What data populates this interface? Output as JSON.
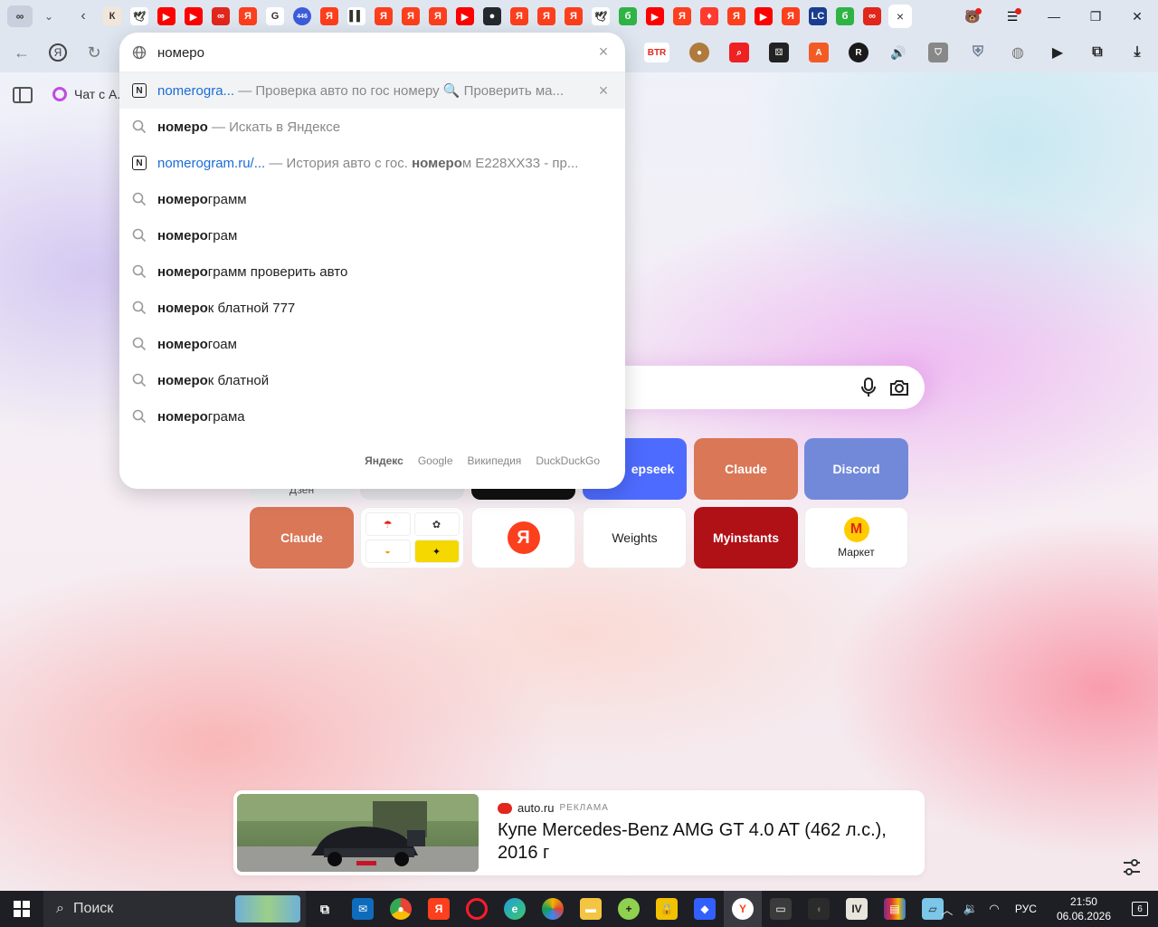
{
  "tabbar": {
    "group_icon": "infinity-icon",
    "tab_count_badge": "446",
    "tabs": [
      {
        "icon": "kitten-icon",
        "color": "#f2e6da",
        "glyph": "К"
      },
      {
        "icon": "bird-icon",
        "color": "#ffffff",
        "glyph": "🕊"
      },
      {
        "icon": "youtube-icon",
        "color": "#ff0000",
        "glyph": "▶"
      },
      {
        "icon": "youtube-icon",
        "color": "#ff0000",
        "glyph": "▶"
      },
      {
        "icon": "autoru-icon",
        "color": "#e1261c",
        "glyph": "∞"
      },
      {
        "icon": "yandex-icon",
        "color": "#fc3f1d",
        "glyph": "Я"
      },
      {
        "icon": "google-icon",
        "color": "#ffffff",
        "glyph": "G"
      },
      {
        "icon": "badge-icon",
        "color": "#3b5bdb",
        "glyph": "446"
      },
      {
        "icon": "yandex-icon",
        "color": "#fc3f1d",
        "glyph": "Я"
      },
      {
        "icon": "audio-icon",
        "color": "#ffffff",
        "glyph": "▌▌"
      },
      {
        "icon": "yandex-icon",
        "color": "#fc3f1d",
        "glyph": "Я"
      },
      {
        "icon": "yandex-icon",
        "color": "#fc3f1d",
        "glyph": "Я"
      },
      {
        "icon": "yandex-icon",
        "color": "#fc3f1d",
        "glyph": "Я"
      },
      {
        "icon": "youtube-icon",
        "color": "#ff0000",
        "glyph": "▶"
      },
      {
        "icon": "github-icon",
        "color": "#24292e",
        "glyph": "●"
      },
      {
        "icon": "yandex-icon",
        "color": "#fc3f1d",
        "glyph": "Я"
      },
      {
        "icon": "yandex-icon",
        "color": "#fc3f1d",
        "glyph": "Я"
      },
      {
        "icon": "yandex-icon",
        "color": "#fc3f1d",
        "glyph": "Я"
      },
      {
        "icon": "bird-icon",
        "color": "#ffffff",
        "glyph": "🕊"
      },
      {
        "icon": "green-icon",
        "color": "#2fb344",
        "glyph": "б"
      },
      {
        "icon": "youtube-icon",
        "color": "#ff0000",
        "glyph": "▶"
      },
      {
        "icon": "yandex-icon",
        "color": "#fc3f1d",
        "glyph": "Я"
      },
      {
        "icon": "fire-icon",
        "color": "#ff3b30",
        "glyph": "♦"
      },
      {
        "icon": "yandex-icon",
        "color": "#fc3f1d",
        "glyph": "Я"
      },
      {
        "icon": "youtube-icon",
        "color": "#ff0000",
        "glyph": "▶"
      },
      {
        "icon": "yandex-icon",
        "color": "#fc3f1d",
        "glyph": "Я"
      },
      {
        "icon": "lc-icon",
        "color": "#1a3d8f",
        "glyph": "LC"
      },
      {
        "icon": "green-icon",
        "color": "#2fb344",
        "glyph": "б"
      },
      {
        "icon": "autoru-icon",
        "color": "#e1261c",
        "glyph": "∞"
      }
    ],
    "close_active_tab": "×"
  },
  "window": {
    "minimize": "—",
    "maximize": "❐",
    "close": "✕"
  },
  "suggest": {
    "query": "номеро",
    "items": [
      {
        "type": "site",
        "link": "nomerogra...",
        "rest": " — Проверка авто по гос номеру 🔍 Проверить ма...",
        "highlighted": true
      },
      {
        "type": "search",
        "bold": "номеро",
        "rest": " — Искать в Яндексе"
      },
      {
        "type": "site",
        "link": "nomerogram.ru/...",
        "rest_a": " — История авто с гос. ",
        "rest_bold": "номеро",
        "rest_b": "м Е228ХХ33 - пр..."
      },
      {
        "type": "search",
        "bold": "номеро",
        "rest": "грамм"
      },
      {
        "type": "search",
        "bold": "номеро",
        "rest": "грам"
      },
      {
        "type": "search",
        "bold": "номеро",
        "rest": "грамм проверить авто"
      },
      {
        "type": "search",
        "bold": "номеро",
        "rest": "к блатной 777"
      },
      {
        "type": "search",
        "bold": "номеро",
        "rest": "гоам"
      },
      {
        "type": "search",
        "bold": "номеро",
        "rest": "к блатной"
      },
      {
        "type": "search",
        "bold": "номеро",
        "rest": "грама"
      }
    ],
    "engines": [
      "Яндекс",
      "Google",
      "Википедия",
      "DuckDuckGo"
    ]
  },
  "sidebar": {
    "alice_chat": "Чат с А..."
  },
  "tiles": {
    "row1": [
      {
        "label": "epseek",
        "color": "#4d6bfe"
      },
      {
        "label": "Claude",
        "color": "#d97757"
      },
      {
        "label": "Discord",
        "color": "#7289da"
      }
    ],
    "row2": [
      {
        "label": "Claude",
        "color": "#d97757"
      },
      {
        "label": "",
        "color": "#ffffff"
      },
      {
        "label": "Я",
        "color": "#ffffff"
      },
      {
        "label": "Weights",
        "color": "#ffffff"
      },
      {
        "label": "Myinstants",
        "color": "#b01116"
      },
      {
        "label": "Маркет",
        "color": "#ffffff"
      }
    ],
    "peek_labels": [
      "Дзен"
    ]
  },
  "ad": {
    "brand": "auto.ru",
    "tag": "РЕКЛАМА",
    "title": "Купе Mercedes-Benz AMG GT 4.0 AT (462 л.с.), 2016 г",
    "brand_color": "#e1261c"
  },
  "taskbar": {
    "search_label": "Поиск",
    "lang": "РУС",
    "time": "21:50",
    "date": "06.06.2026",
    "notifications": "6"
  }
}
